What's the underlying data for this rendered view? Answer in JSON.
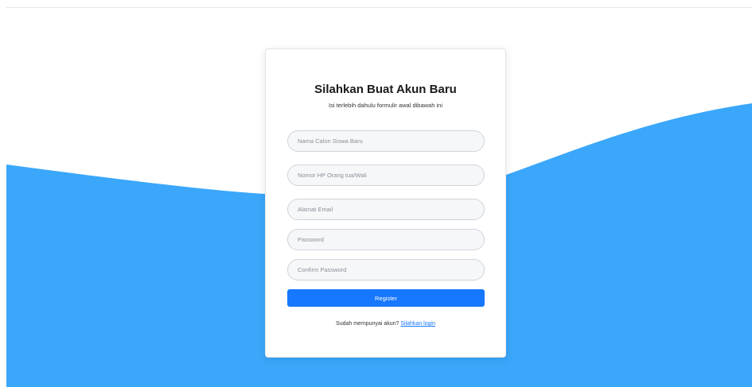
{
  "colors": {
    "wave": "#3aa7fb",
    "button": "#1677ff",
    "link": "#1677ff"
  },
  "form": {
    "title": "Silahkan Buat Akun Baru",
    "subtitle": "Isi terlebih dahulu formulir awal dibawah ini",
    "fields": [
      {
        "placeholder": "Nama Calon Siswa Baru"
      },
      {
        "placeholder": "Nomor HP Orang tua/Wali"
      },
      {
        "placeholder": "Alamat Email"
      },
      {
        "placeholder": "Password"
      },
      {
        "placeholder": "Confirm Password"
      }
    ],
    "register_label": "Register",
    "login_prompt": "Sudah mempunyai akun?",
    "login_link": "Silahkan login"
  }
}
